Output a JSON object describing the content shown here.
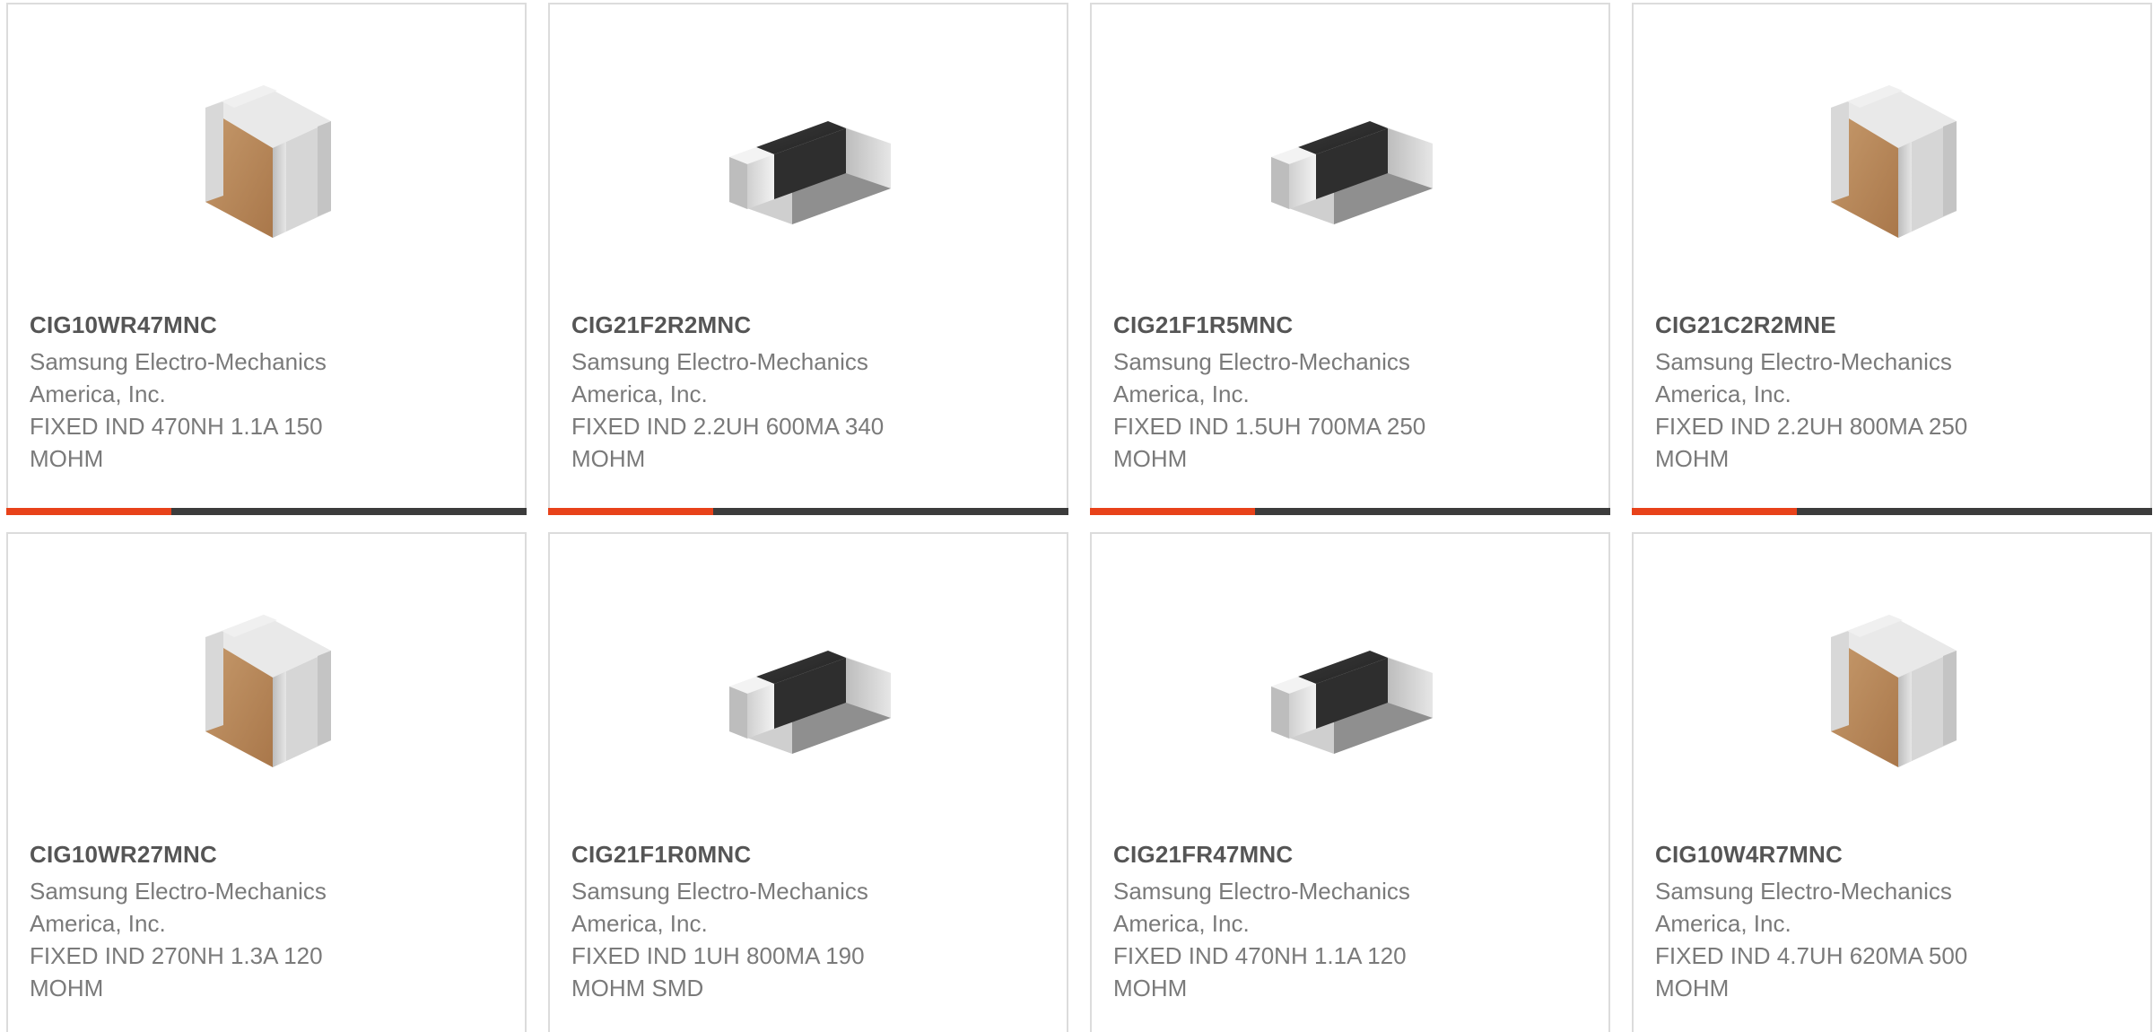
{
  "colors": {
    "accent": "#e8421a",
    "bar": "#3c3c3c",
    "border": "#dcdcdc",
    "title": "#555555",
    "text": "#7a7a7a"
  },
  "products": [
    {
      "part_number": "CIG10WR47MNC",
      "manufacturer_line1": "Samsung Electro-Mechanics",
      "manufacturer_line2": "America, Inc.",
      "description_line1": "FIXED IND 470NH 1.1A 150",
      "description_line2": "MOHM",
      "image_icon": "chip-inductor-brown-icon"
    },
    {
      "part_number": "CIG21F2R2MNC",
      "manufacturer_line1": "Samsung Electro-Mechanics",
      "manufacturer_line2": "America, Inc.",
      "description_line1": "FIXED IND 2.2UH 600MA 340",
      "description_line2": "MOHM",
      "image_icon": "chip-inductor-black-icon"
    },
    {
      "part_number": "CIG21F1R5MNC",
      "manufacturer_line1": "Samsung Electro-Mechanics",
      "manufacturer_line2": "America, Inc.",
      "description_line1": "FIXED IND 1.5UH 700MA 250",
      "description_line2": "MOHM",
      "image_icon": "chip-inductor-black-icon"
    },
    {
      "part_number": "CIG21C2R2MNE",
      "manufacturer_line1": "Samsung Electro-Mechanics",
      "manufacturer_line2": "America, Inc.",
      "description_line1": "FIXED IND 2.2UH 800MA 250",
      "description_line2": "MOHM",
      "image_icon": "chip-inductor-brown-icon"
    },
    {
      "part_number": "CIG10WR27MNC",
      "manufacturer_line1": "Samsung Electro-Mechanics",
      "manufacturer_line2": "America, Inc.",
      "description_line1": "FIXED IND 270NH 1.3A 120",
      "description_line2": "MOHM",
      "image_icon": "chip-inductor-brown-icon"
    },
    {
      "part_number": "CIG21F1R0MNC",
      "manufacturer_line1": "Samsung Electro-Mechanics",
      "manufacturer_line2": "America, Inc.",
      "description_line1": "FIXED IND 1UH 800MA 190",
      "description_line2": "MOHM SMD",
      "image_icon": "chip-inductor-black-icon"
    },
    {
      "part_number": "CIG21FR47MNC",
      "manufacturer_line1": "Samsung Electro-Mechanics",
      "manufacturer_line2": "America, Inc.",
      "description_line1": "FIXED IND 470NH 1.1A 120",
      "description_line2": "MOHM",
      "image_icon": "chip-inductor-black-icon"
    },
    {
      "part_number": "CIG10W4R7MNC",
      "manufacturer_line1": "Samsung Electro-Mechanics",
      "manufacturer_line2": "America, Inc.",
      "description_line1": "FIXED IND 4.7UH 620MA 500",
      "description_line2": "MOHM",
      "image_icon": "chip-inductor-brown-icon"
    }
  ]
}
